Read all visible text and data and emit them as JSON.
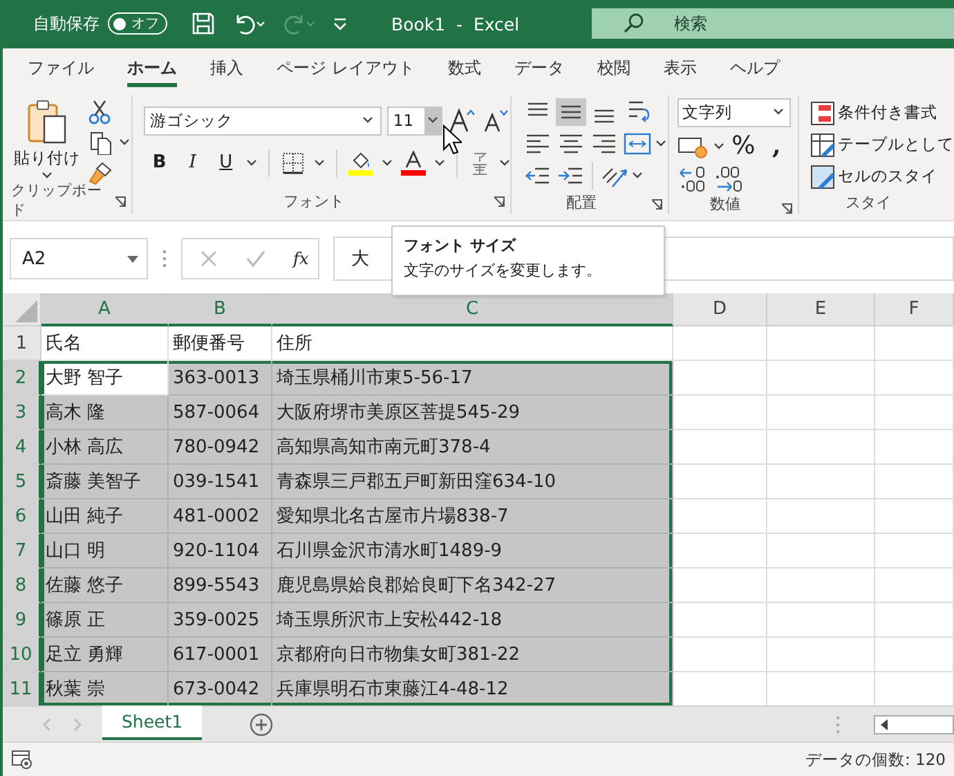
{
  "title_bar": {
    "autosave_label": "自動保存",
    "autosave_toggle": {
      "label": "オフ",
      "on": false
    },
    "document_title": "Book1  -  Excel",
    "search": {
      "placeholder": "検索"
    }
  },
  "menu_tabs": [
    {
      "label": "ファイル",
      "selected": false
    },
    {
      "label": "ホーム",
      "selected": true
    },
    {
      "label": "挿入",
      "selected": false
    },
    {
      "label": "ページ レイアウト",
      "selected": false
    },
    {
      "label": "数式",
      "selected": false
    },
    {
      "label": "データ",
      "selected": false
    },
    {
      "label": "校閲",
      "selected": false
    },
    {
      "label": "表示",
      "selected": false
    },
    {
      "label": "ヘルプ",
      "selected": false
    }
  ],
  "ribbon": {
    "clipboard": {
      "label": "クリップボード",
      "paste_label": "貼り付け"
    },
    "font": {
      "label": "フォント",
      "font_name": "游ゴシック",
      "font_size": "11",
      "size_dropdown_hovered": true,
      "bold": "B",
      "italic": "I",
      "underline": "U"
    },
    "alignment": {
      "label": "配置",
      "middle_align_selected": true
    },
    "number": {
      "label": "数値",
      "format": "文字列",
      "percent": "%",
      "comma": ","
    },
    "styles": {
      "label": "スタイ",
      "items": [
        "条件付き書式",
        "テーブルとして",
        "セルのスタイ"
      ]
    }
  },
  "tooltip": {
    "title": "フォント サイズ",
    "text": "文字のサイズを変更します。"
  },
  "formula_bar": {
    "name_box": "A2",
    "fx": "fx",
    "value": "大"
  },
  "columns": [
    {
      "label": "A",
      "selected": true
    },
    {
      "label": "B",
      "selected": true
    },
    {
      "label": "C",
      "selected": true
    },
    {
      "label": "D",
      "selected": false
    },
    {
      "label": "E",
      "selected": false
    },
    {
      "label": "F",
      "selected": false
    }
  ],
  "rows": [
    {
      "number": "1",
      "selected": false,
      "cells": [
        "氏名",
        "郵便番号",
        "住所"
      ]
    },
    {
      "number": "2",
      "selected": true,
      "cells": [
        "大野 智子",
        "363-0013",
        "埼玉県桶川市東5-56-17"
      ]
    },
    {
      "number": "3",
      "selected": true,
      "cells": [
        "高木 隆",
        "587-0064",
        "大阪府堺市美原区菩提545-29"
      ]
    },
    {
      "number": "4",
      "selected": true,
      "cells": [
        "小林 高広",
        "780-0942",
        "高知県高知市南元町378-4"
      ]
    },
    {
      "number": "5",
      "selected": true,
      "cells": [
        "斎藤 美智子",
        "039-1541",
        "青森県三戸郡五戸町新田窪634-10"
      ]
    },
    {
      "number": "6",
      "selected": true,
      "cells": [
        "山田 純子",
        "481-0002",
        "愛知県北名古屋市片場838-7"
      ]
    },
    {
      "number": "7",
      "selected": true,
      "cells": [
        "山口 明",
        "920-1104",
        "石川県金沢市清水町1489-9"
      ]
    },
    {
      "number": "8",
      "selected": true,
      "cells": [
        "佐藤 悠子",
        "899-5543",
        "鹿児島県姶良郡姶良町下名342-27"
      ]
    },
    {
      "number": "9",
      "selected": true,
      "cells": [
        "篠原 正",
        "359-0025",
        "埼玉県所沢市上安松442-18"
      ]
    },
    {
      "number": "10",
      "selected": true,
      "cells": [
        "足立 勇輝",
        "617-0001",
        "京都府向日市物集女町381-22"
      ]
    },
    {
      "number": "11",
      "selected": true,
      "cells": [
        "秋葉 崇",
        "673-0042",
        "兵庫県明石市東藤江4-48-12"
      ]
    }
  ],
  "sheet_tabs": [
    {
      "label": "Sheet1",
      "selected": true
    }
  ],
  "status_bar": {
    "text": "データの個数: 120"
  }
}
